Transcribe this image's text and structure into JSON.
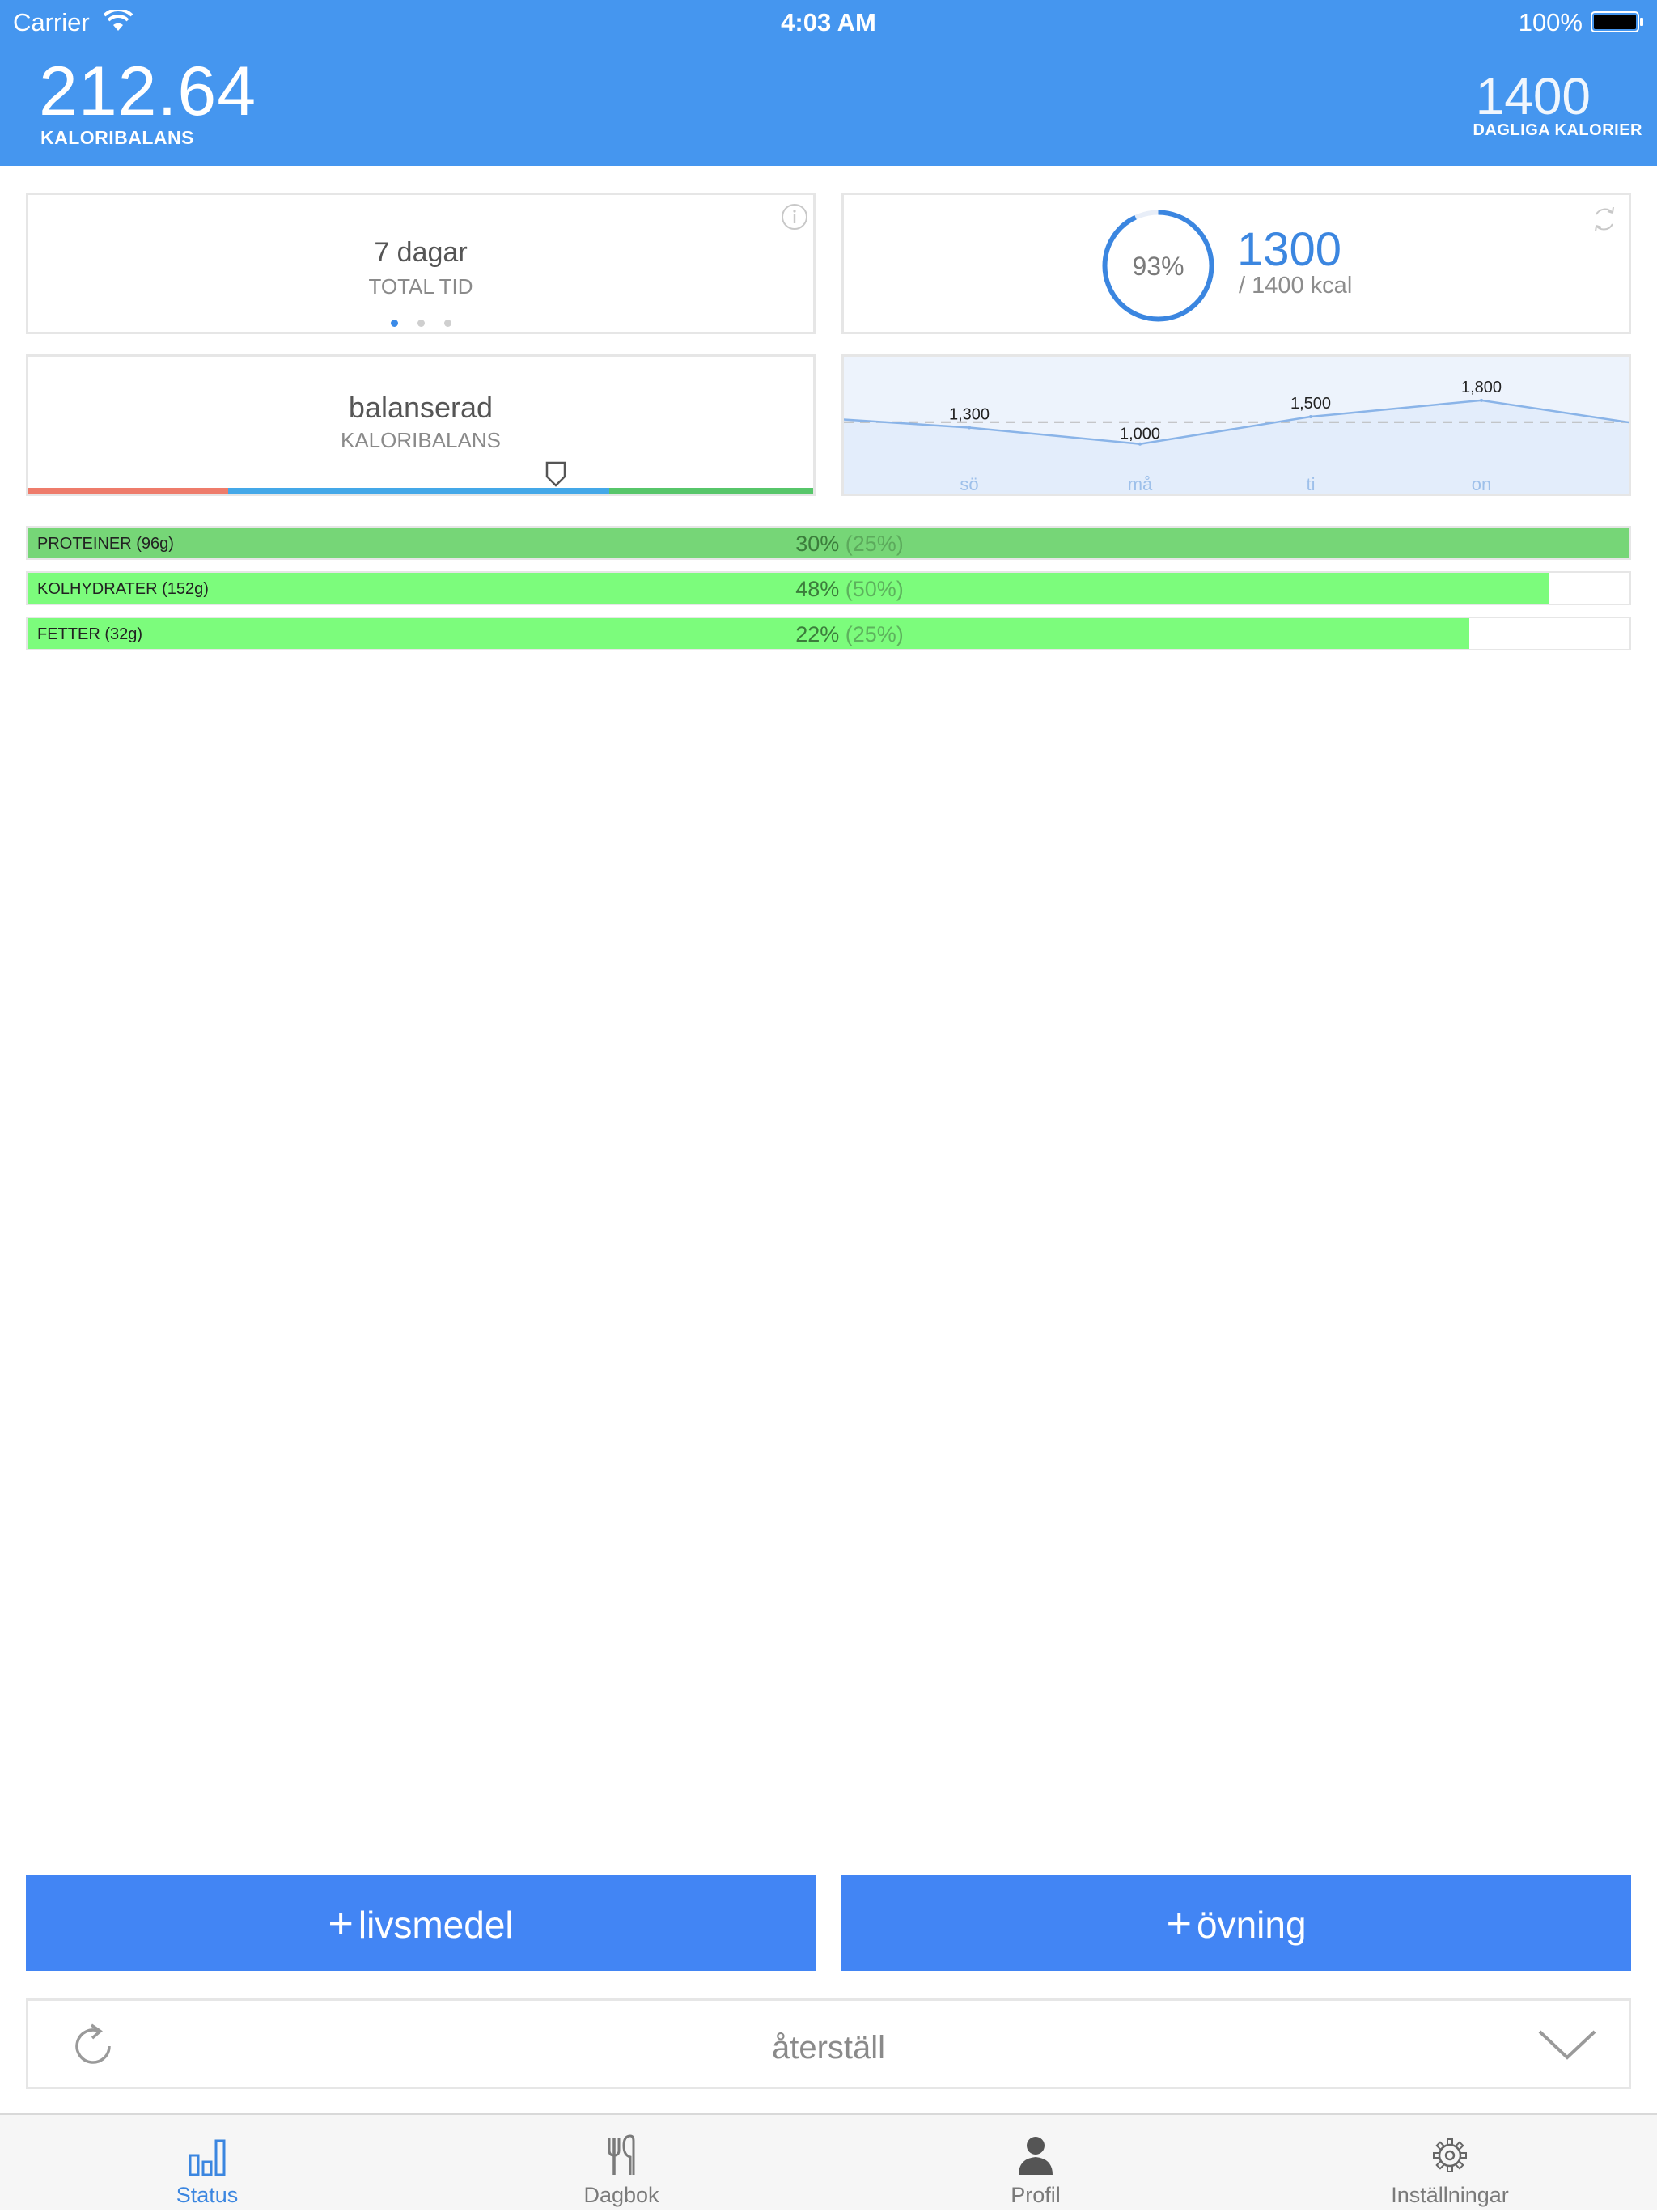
{
  "status_bar": {
    "carrier": "Carrier",
    "time": "4:03 AM",
    "battery": "100%"
  },
  "header": {
    "balance_value": "212.64",
    "balance_label": "KALORIBALANS",
    "daily_value": "1400",
    "daily_label": "DAGLIGA KALORIER"
  },
  "cards": {
    "time": {
      "value": "7 dagar",
      "label": "TOTAL TID"
    },
    "goal": {
      "percent": "93%",
      "progress": 0.93,
      "value": "1300",
      "of": "/ 1400 kcal"
    },
    "balance": {
      "value": "balanserad",
      "label": "KALORIBALANS"
    }
  },
  "chart_data": {
    "type": "area",
    "categories": [
      "sö",
      "må",
      "ti",
      "on"
    ],
    "series": [
      {
        "values": [
          1300,
          1000,
          1500,
          1800
        ]
      }
    ],
    "reference_line": 1400,
    "data_labels": [
      "1,300",
      "1,000",
      "1,500",
      "1,800"
    ],
    "ylim": [
      0,
      2600
    ],
    "colors": {
      "line": "#8ab4e8",
      "fill": "#e3edfb",
      "labels": "#9ec0ea"
    }
  },
  "macros": [
    {
      "name": "PROTEINER (96g)",
      "actual": "30%",
      "target": "(25%)",
      "fill": 1.0,
      "color": "#76d677"
    },
    {
      "name": "KOLHYDRATER (152g)",
      "actual": "48%",
      "target": "(50%)",
      "fill": 0.95,
      "color": "#7cfc7c"
    },
    {
      "name": "FETTER (32g)",
      "actual": "22%",
      "target": "(25%)",
      "fill": 0.9,
      "color": "#7cfc7c"
    }
  ],
  "actions": {
    "food": "livsmedel",
    "exercise": "övning",
    "plus": "+"
  },
  "reset": {
    "label": "återställ"
  },
  "tabs": [
    {
      "label": "Status",
      "icon": "bar-chart-icon"
    },
    {
      "label": "Dagbok",
      "icon": "fork-knife-icon"
    },
    {
      "label": "Profil",
      "icon": "person-icon"
    },
    {
      "label": "Inställningar",
      "icon": "gear-icon"
    }
  ],
  "colors": {
    "header": "#4596ef",
    "accent": "#3b86e0",
    "button": "#4285f4"
  }
}
